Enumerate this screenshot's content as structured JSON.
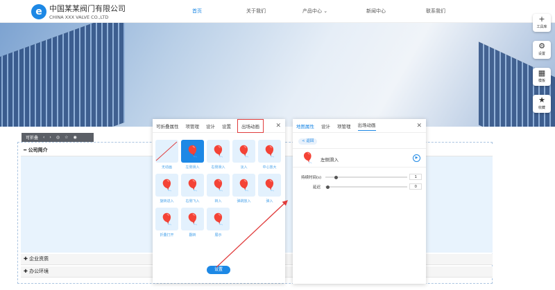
{
  "header": {
    "logo_cn": "中国某某阀门有限公司",
    "logo_en": "CHINA XXX VALVE CO.,LTD",
    "logo_glyph": "e",
    "nav": [
      "首页",
      "关于我们",
      "产品中心",
      "新闻中心",
      "联系我们"
    ],
    "nav_active_color": "#1d88e5"
  },
  "toolbar_right": [
    {
      "icon": "plus-icon",
      "label": "工具库"
    },
    {
      "icon": "gear-icon",
      "label": "设置"
    },
    {
      "icon": "template-icon",
      "label": "模板"
    },
    {
      "icon": "star-icon",
      "label": "收藏"
    }
  ],
  "fold_toolbar": {
    "label": "可折叠"
  },
  "sections": {
    "expanded": "公司简介",
    "collapsed": [
      "企业资质",
      "办公环境"
    ]
  },
  "panel1": {
    "tabs": [
      "可折叠属性",
      "项管理",
      "设计",
      "设置",
      "出场动画"
    ],
    "active_tab": 4,
    "animations": [
      "无动画",
      "左侧滑入",
      "右侧滑入",
      "淡入",
      "中心放大",
      "旋转进入",
      "右侧飞入",
      "转入",
      "弹跳放入",
      "弹入",
      "折叠打开",
      "翻转",
      "展示"
    ],
    "selected": 1,
    "button": "设置"
  },
  "panel2": {
    "tabs": [
      "地图属性",
      "设计",
      "项管理",
      "出场动画"
    ],
    "active_tab": 3,
    "back": "< 返回",
    "animation_name": "左侧滑入",
    "duration_label": "持续时间(s)",
    "duration_value": "1",
    "delay_label": "延迟",
    "delay_value": "0"
  }
}
